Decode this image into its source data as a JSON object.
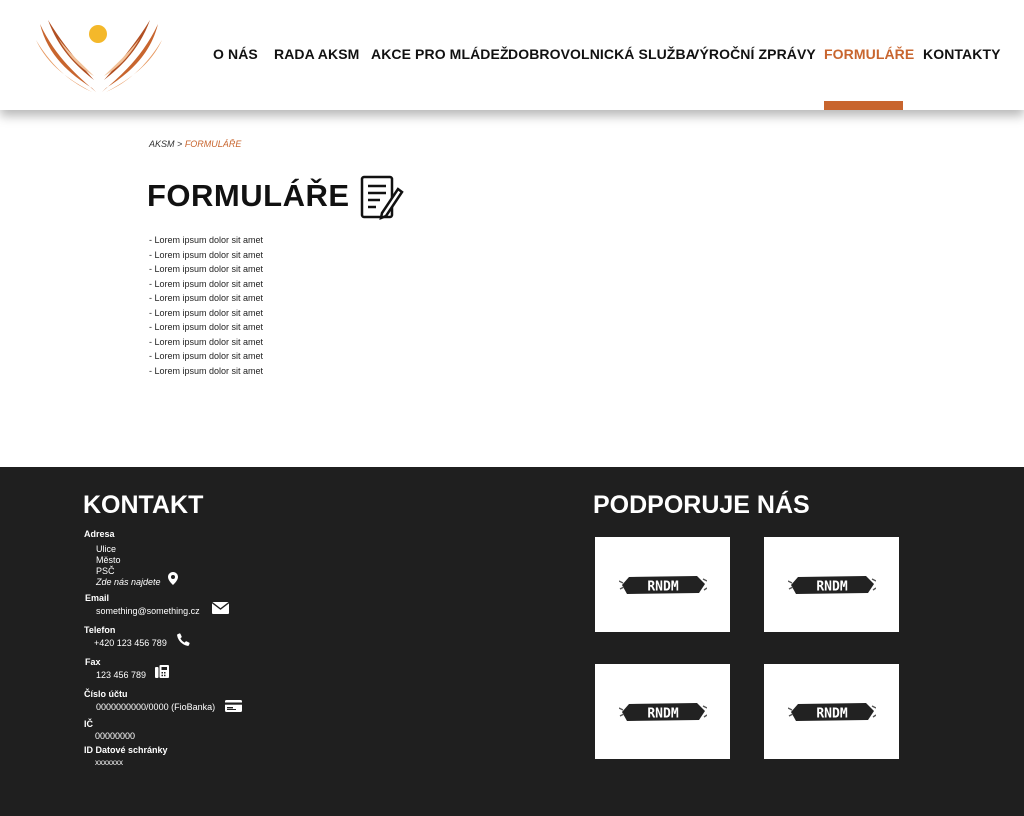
{
  "nav": {
    "items": [
      {
        "label": "O NÁS"
      },
      {
        "label": "RADA AKSM"
      },
      {
        "label": "AKCE PRO MLÁDEŽ"
      },
      {
        "label": "DOBROVOLNICKÁ SLUŽBA"
      },
      {
        "label": "VÝROČNÍ ZPRÁVY"
      },
      {
        "label": "FORMULÁŘE"
      },
      {
        "label": "KONTAKTY"
      }
    ],
    "active": "FORMULÁŘE"
  },
  "breadcrumb": {
    "root": "AKSM",
    "separator": ">",
    "current": "FORMULÁŘE"
  },
  "page": {
    "title": "FORMULÁŘE",
    "items": [
      "- Lorem ipsum dolor sit amet",
      "- Lorem ipsum dolor sit amet",
      "- Lorem ipsum dolor sit amet",
      "- Lorem ipsum dolor sit amet",
      "- Lorem ipsum dolor sit amet",
      "- Lorem ipsum dolor sit amet",
      "- Lorem ipsum dolor sit amet",
      "- Lorem ipsum dolor sit amet",
      "- Lorem ipsum dolor sit amet",
      "- Lorem ipsum dolor sit amet"
    ]
  },
  "footer": {
    "kontakt_title": "KONTAKT",
    "adresa_label": "Adresa",
    "street": "Ulice",
    "city": "Město",
    "psc": "PSČ",
    "map_link": "Zde nás najdete",
    "email_label": "Email",
    "email": "something@something.cz",
    "telefon_label": "Telefon",
    "telefon": "+420 123 456 789",
    "fax_label": "Fax",
    "fax": "123 456 789",
    "ucet_label": "Číslo účtu",
    "ucet": "0000000000/0000 (FioBanka)",
    "ic_label": "IČ",
    "ic": "00000000",
    "datova_label": "ID Datové schránky",
    "datova": "xxxxxxx",
    "podporuje_title": "PODPORUJE NÁS",
    "sponsors": [
      {
        "name": "RNDM"
      },
      {
        "name": "RNDM"
      },
      {
        "name": "RNDM"
      },
      {
        "name": "RNDM"
      }
    ]
  },
  "colors": {
    "accent": "#c8652e",
    "footer_bg": "#1f1f1f"
  },
  "icons": [
    "logo-hands-sun-icon",
    "form-document-pen-icon",
    "map-pin-icon",
    "envelope-icon",
    "phone-icon",
    "fax-icon",
    "credit-card-icon"
  ]
}
